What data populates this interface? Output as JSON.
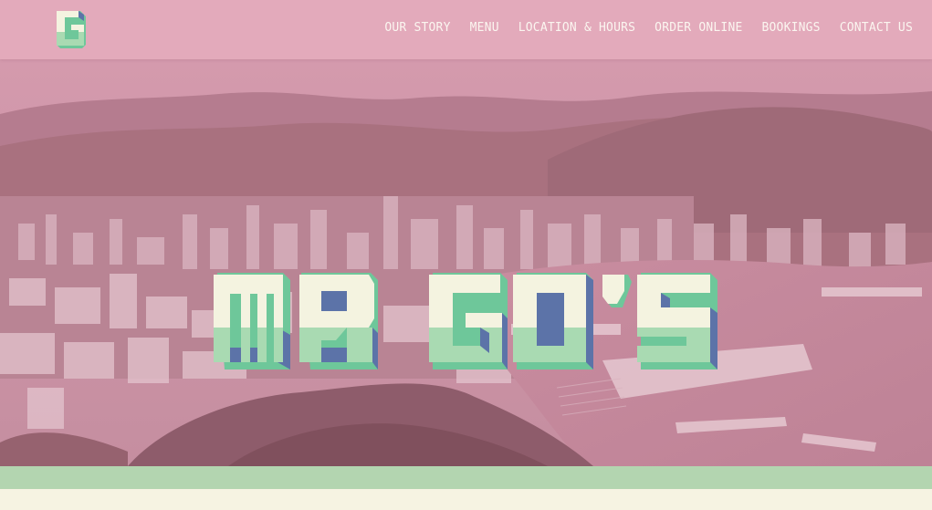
{
  "site": {
    "name": "MR GO'S",
    "logo_letter": "G"
  },
  "nav": {
    "items": [
      {
        "label": "OUR STORY"
      },
      {
        "label": "MENU"
      },
      {
        "label": "LOCATION & HOURS"
      },
      {
        "label": "ORDER ONLINE"
      },
      {
        "label": "BOOKINGS"
      },
      {
        "label": "CONTACT US"
      }
    ]
  },
  "hero": {
    "image_description": "Tinted aerial view of a harbour city with hills",
    "title": "MR GO'S"
  },
  "colors": {
    "header_bg": "#e3aabb",
    "hero_tint": "#c98aa0",
    "title_cream": "#f4f3e0",
    "title_mint": "#a9dab2",
    "title_teal": "#6ec79a",
    "title_blue": "#5c73a8",
    "stripe": "#b3d5b0",
    "page_bg": "#f6f3e2"
  }
}
